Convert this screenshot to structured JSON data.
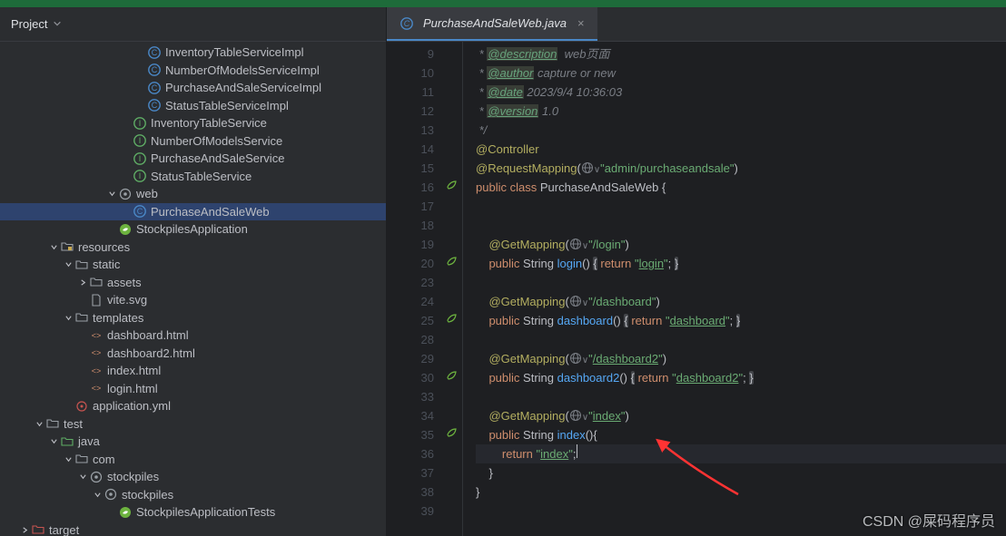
{
  "sidebar": {
    "title": "Project",
    "tree": [
      {
        "indent": 9,
        "icon": "class-c",
        "label": "InventoryTableServiceImpl"
      },
      {
        "indent": 9,
        "icon": "class-c",
        "label": "NumberOfModelsServiceImpl"
      },
      {
        "indent": 9,
        "icon": "class-c",
        "label": "PurchaseAndSaleServiceImpl"
      },
      {
        "indent": 9,
        "icon": "class-c",
        "label": "StatusTableServiceImpl"
      },
      {
        "indent": 8,
        "icon": "interface-i",
        "label": "InventoryTableService"
      },
      {
        "indent": 8,
        "icon": "interface-i",
        "label": "NumberOfModelsService"
      },
      {
        "indent": 8,
        "icon": "interface-i",
        "label": "PurchaseAndSaleService"
      },
      {
        "indent": 8,
        "icon": "interface-i",
        "label": "StatusTableService"
      },
      {
        "indent": 7,
        "arrow": "down",
        "icon": "package",
        "label": "web"
      },
      {
        "indent": 8,
        "icon": "class-c",
        "label": "PurchaseAndSaleWeb",
        "selected": true
      },
      {
        "indent": 7,
        "icon": "spring",
        "label": "StockpilesApplication"
      },
      {
        "indent": 3,
        "arrow": "down",
        "icon": "folder-res",
        "label": "resources"
      },
      {
        "indent": 4,
        "arrow": "down",
        "icon": "folder",
        "label": "static"
      },
      {
        "indent": 5,
        "arrow": "right",
        "icon": "folder",
        "label": "assets"
      },
      {
        "indent": 5,
        "icon": "file",
        "label": "vite.svg"
      },
      {
        "indent": 4,
        "arrow": "down",
        "icon": "folder",
        "label": "templates"
      },
      {
        "indent": 5,
        "icon": "html",
        "label": "dashboard.html"
      },
      {
        "indent": 5,
        "icon": "html",
        "label": "dashboard2.html"
      },
      {
        "indent": 5,
        "icon": "html",
        "label": "index.html"
      },
      {
        "indent": 5,
        "icon": "html",
        "label": "login.html"
      },
      {
        "indent": 4,
        "icon": "yml",
        "label": "application.yml"
      },
      {
        "indent": 2,
        "arrow": "down",
        "icon": "folder",
        "label": "test"
      },
      {
        "indent": 3,
        "arrow": "down",
        "icon": "folder-test",
        "label": "java"
      },
      {
        "indent": 4,
        "arrow": "down",
        "icon": "folder",
        "label": "com"
      },
      {
        "indent": 5,
        "arrow": "down",
        "icon": "package",
        "label": "stockpiles"
      },
      {
        "indent": 6,
        "arrow": "down",
        "icon": "package",
        "label": "stockpiles"
      },
      {
        "indent": 7,
        "icon": "spring",
        "label": "StockpilesApplicationTests"
      },
      {
        "indent": 1,
        "arrow": "right",
        "icon": "folder-ex",
        "label": "target"
      }
    ]
  },
  "tab": {
    "label": "PurchaseAndSaleWeb.java"
  },
  "code": {
    "lines": [
      {
        "n": 9,
        "t": "doc",
        "parts": [
          " * ",
          {
            "tag": "@description"
          },
          "  web页面"
        ]
      },
      {
        "n": 10,
        "t": "doc",
        "parts": [
          " * ",
          {
            "tag": "@author"
          },
          " capture or new"
        ]
      },
      {
        "n": 11,
        "t": "doc",
        "parts": [
          " * ",
          {
            "tag": "@date"
          },
          " 2023/9/4 10:36:03"
        ]
      },
      {
        "n": 12,
        "t": "doc",
        "parts": [
          " * ",
          {
            "tag": "@version"
          },
          " 1.0"
        ]
      },
      {
        "n": 13,
        "t": "doc",
        "parts": [
          " */"
        ]
      },
      {
        "n": 14,
        "t": "ann",
        "text": "@Controller"
      },
      {
        "n": 15,
        "t": "mapping",
        "ann": "@RequestMapping",
        "url": "admin/purchaseandsale",
        "quoted": true
      },
      {
        "n": 16,
        "t": "classdecl",
        "gicon": true
      },
      {
        "n": 17,
        "t": "blank"
      },
      {
        "n": 18,
        "t": "blank"
      },
      {
        "n": 19,
        "t": "mapping",
        "indent": 1,
        "ann": "@GetMapping",
        "url": "/login"
      },
      {
        "n": 20,
        "t": "method",
        "gicon": true,
        "name": "login",
        "ret": "login"
      },
      {
        "n": 23,
        "t": "blank"
      },
      {
        "n": 24,
        "t": "mapping",
        "indent": 1,
        "ann": "@GetMapping",
        "url": "/dashboard"
      },
      {
        "n": 25,
        "t": "method",
        "gicon": true,
        "name": "dashboard",
        "ret": "dashboard"
      },
      {
        "n": 28,
        "t": "blank"
      },
      {
        "n": 29,
        "t": "mapping",
        "indent": 1,
        "ann": "@GetMapping",
        "url": "/dashboard2",
        "urlunder": true
      },
      {
        "n": 30,
        "t": "method",
        "gicon": true,
        "name": "dashboard2",
        "ret": "dashboard2"
      },
      {
        "n": 33,
        "t": "blank"
      },
      {
        "n": 34,
        "t": "mapping",
        "indent": 1,
        "ann": "@GetMapping",
        "url": "index",
        "urlunder": true
      },
      {
        "n": 35,
        "t": "methodopen",
        "gicon": true,
        "name": "index"
      },
      {
        "n": 36,
        "t": "returnline",
        "current": true,
        "ret": "index"
      },
      {
        "n": 37,
        "t": "closebrace1"
      },
      {
        "n": 38,
        "t": "closebrace0"
      },
      {
        "n": 39,
        "t": "blank"
      }
    ]
  },
  "watermark": "CSDN @屎码程序员"
}
